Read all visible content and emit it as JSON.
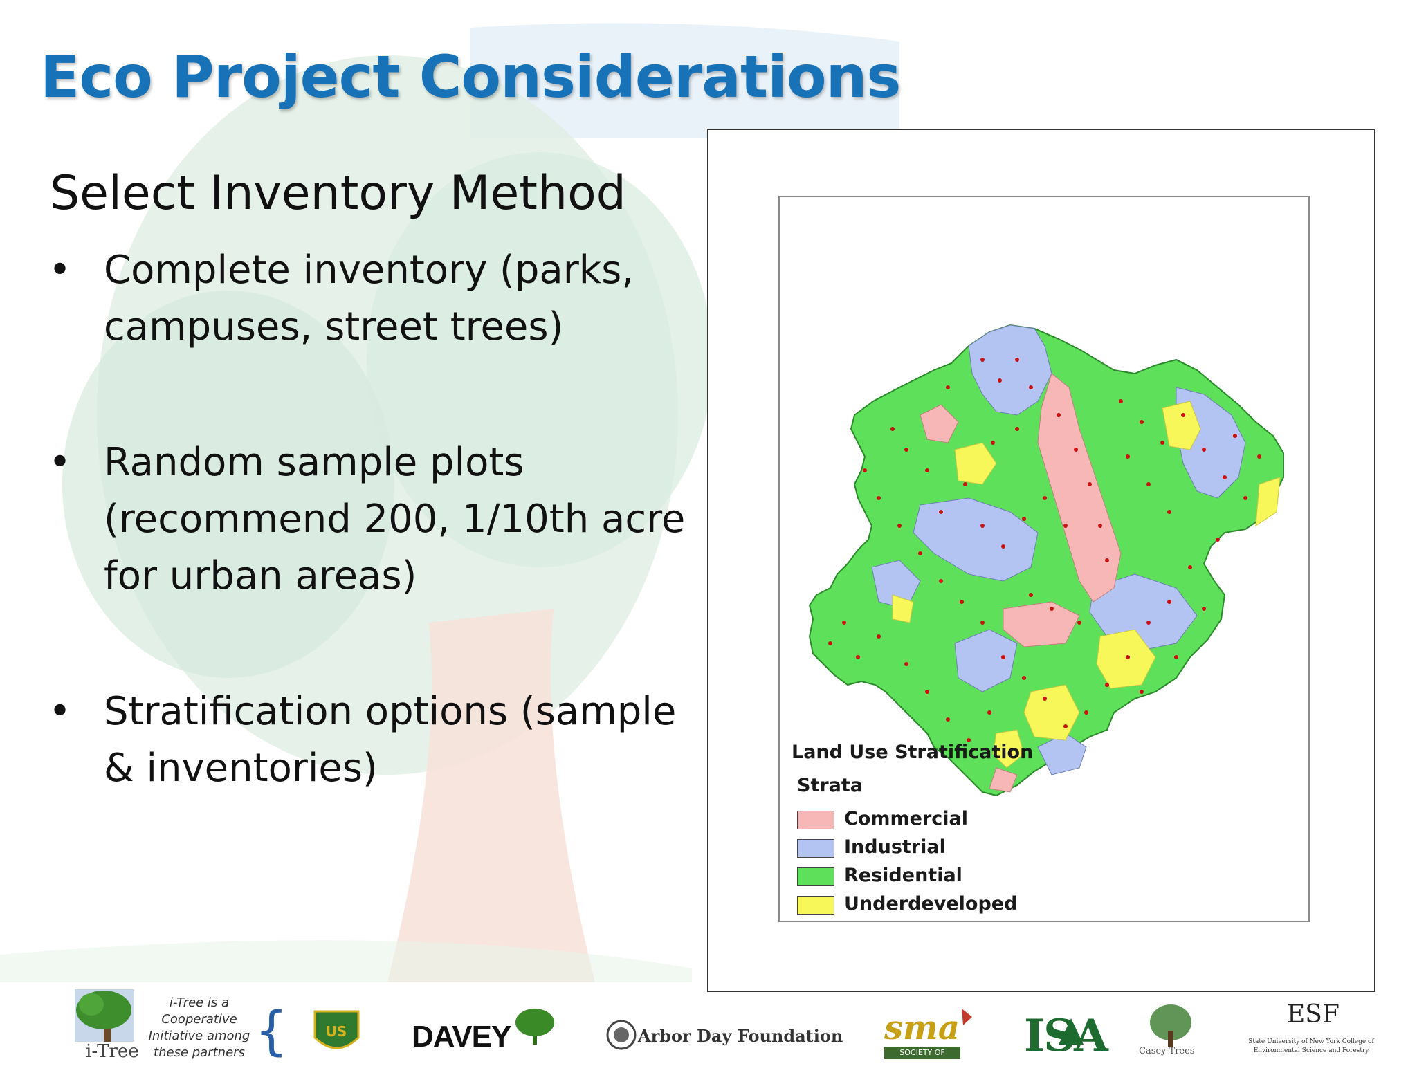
{
  "slide": {
    "title": "Eco Project Considerations",
    "subtitle": "Select Inventory Method",
    "bullets": [
      {
        "lines": [
          "Complete inventory (parks,",
          "campuses, street trees)"
        ]
      },
      {
        "lines": [
          "Random sample plots",
          "(recommend 200, 1/10th acre",
          "for urban areas)"
        ]
      },
      {
        "lines": [
          "Stratification options (sample",
          "& inventories)"
        ]
      }
    ]
  },
  "map": {
    "legend_title": "Land Use Stratification",
    "legend_subtitle": "Strata",
    "legend_items": [
      {
        "label": "Commercial",
        "color": "#f7b7b7"
      },
      {
        "label": "Industrial",
        "color": "#b3c3f2"
      },
      {
        "label": "Residential",
        "color": "#5ee05a"
      },
      {
        "label": "Underdeveloped",
        "color": "#f7f75a"
      }
    ],
    "plot_color": "#cc1111"
  },
  "footer": {
    "itree_label": "i-Tree",
    "partner_note": "i-Tree is a Cooperative Initiative among these partners",
    "logos": {
      "davey": "DAVEY",
      "arbor": "Arbor Day Foundation",
      "sma": "sma",
      "sma_sub": "SOCIETY OF MUNICIPAL ARBORISTS",
      "isa": "ISA",
      "casey": "Casey Trees",
      "esf": "ESF",
      "esf_sub": "State University of New York College of Environmental Science and Forestry"
    }
  }
}
